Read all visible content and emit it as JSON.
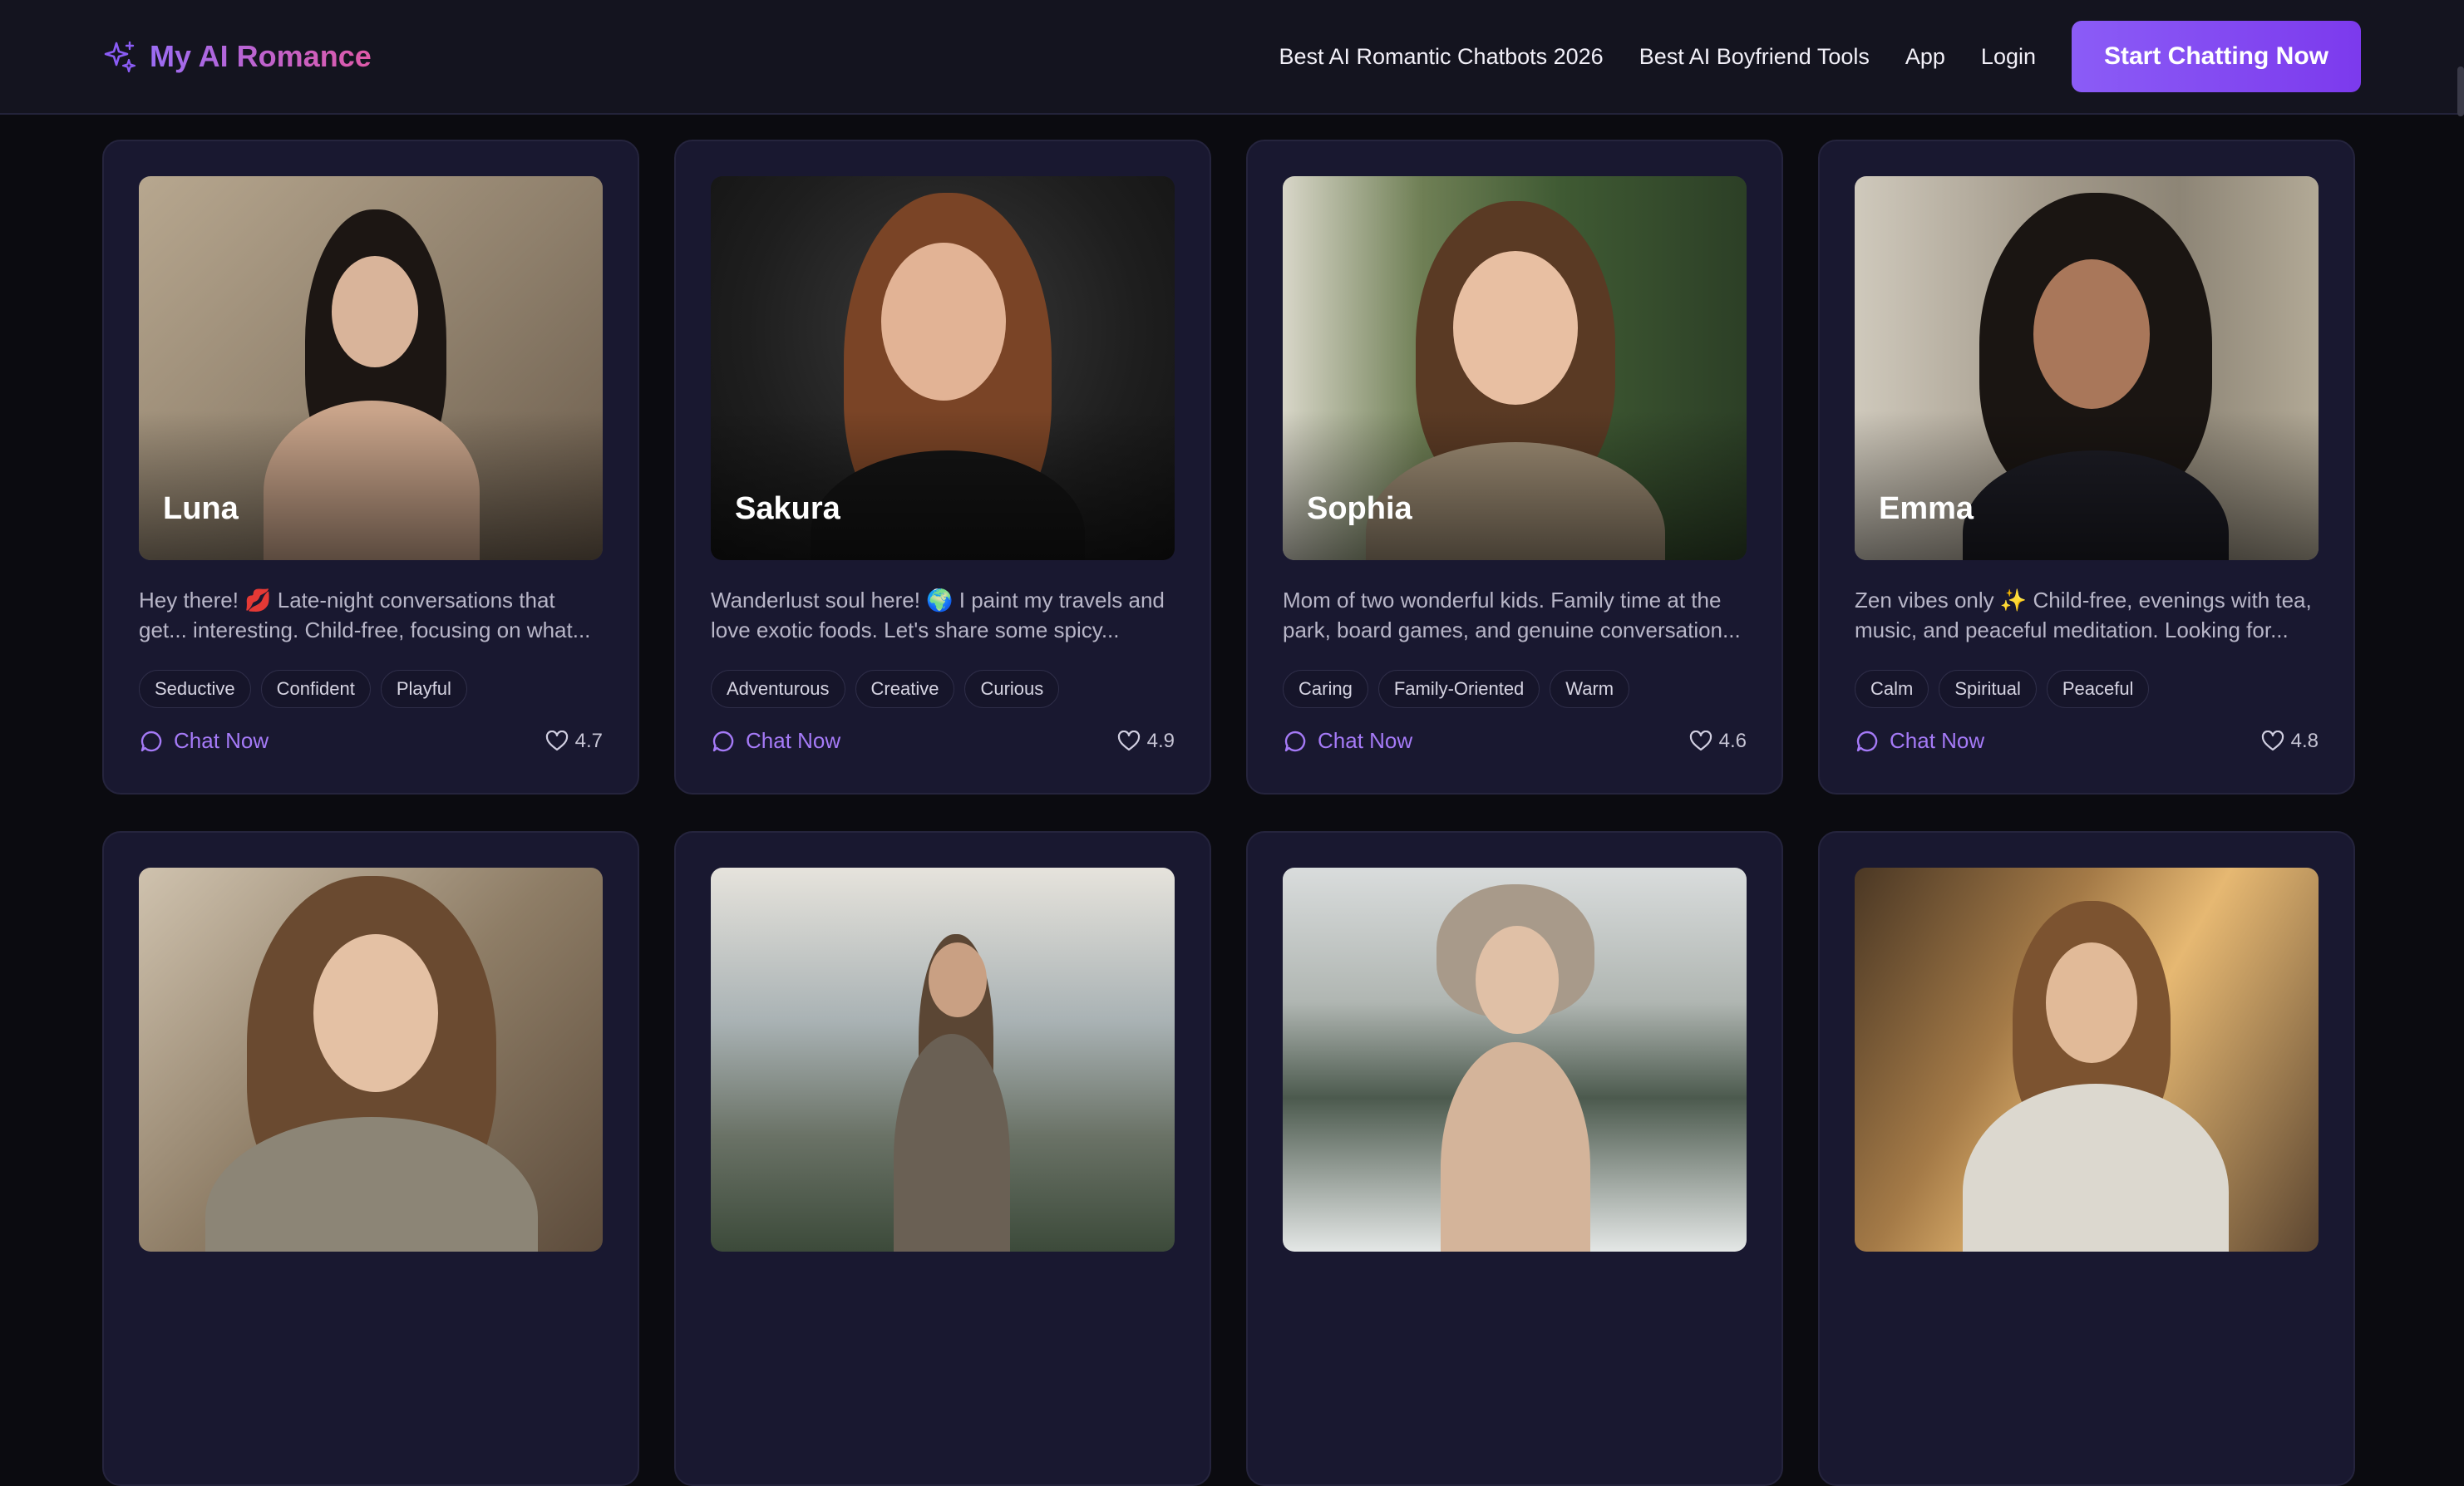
{
  "header": {
    "logo_text": "My AI Romance",
    "nav": [
      "Best AI Romantic Chatbots 2026",
      "Best AI Boyfriend Tools",
      "App",
      "Login"
    ],
    "cta_label": "Start Chatting Now"
  },
  "colors": {
    "accent": "#8b5cf6",
    "card_bg": "#191830",
    "page_bg": "#0b0b10"
  },
  "icons": {
    "logo": "sparkles-icon",
    "chat": "chat-bubble-icon",
    "rating": "heart-icon"
  },
  "cards": [
    {
      "name": "Luna",
      "description": "Hey there! 💋 Late-night conversations that get... interesting. Child-free, focusing on what...",
      "tags": [
        "Seductive",
        "Confident",
        "Playful"
      ],
      "chat_label": "Chat Now",
      "rating": "4.7"
    },
    {
      "name": "Sakura",
      "description": "Wanderlust soul here! 🌍 I paint my travels and love exotic foods. Let's share some spicy...",
      "tags": [
        "Adventurous",
        "Creative",
        "Curious"
      ],
      "chat_label": "Chat Now",
      "rating": "4.9"
    },
    {
      "name": "Sophia",
      "description": "Mom of two wonderful kids. Family time at the park, board games, and genuine conversation...",
      "tags": [
        "Caring",
        "Family-Oriented",
        "Warm"
      ],
      "chat_label": "Chat Now",
      "rating": "4.6"
    },
    {
      "name": "Emma",
      "description": "Zen vibes only ✨ Child-free, evenings with tea, music, and peaceful meditation. Looking for...",
      "tags": [
        "Calm",
        "Spiritual",
        "Peaceful"
      ],
      "chat_label": "Chat Now",
      "rating": "4.8"
    }
  ]
}
